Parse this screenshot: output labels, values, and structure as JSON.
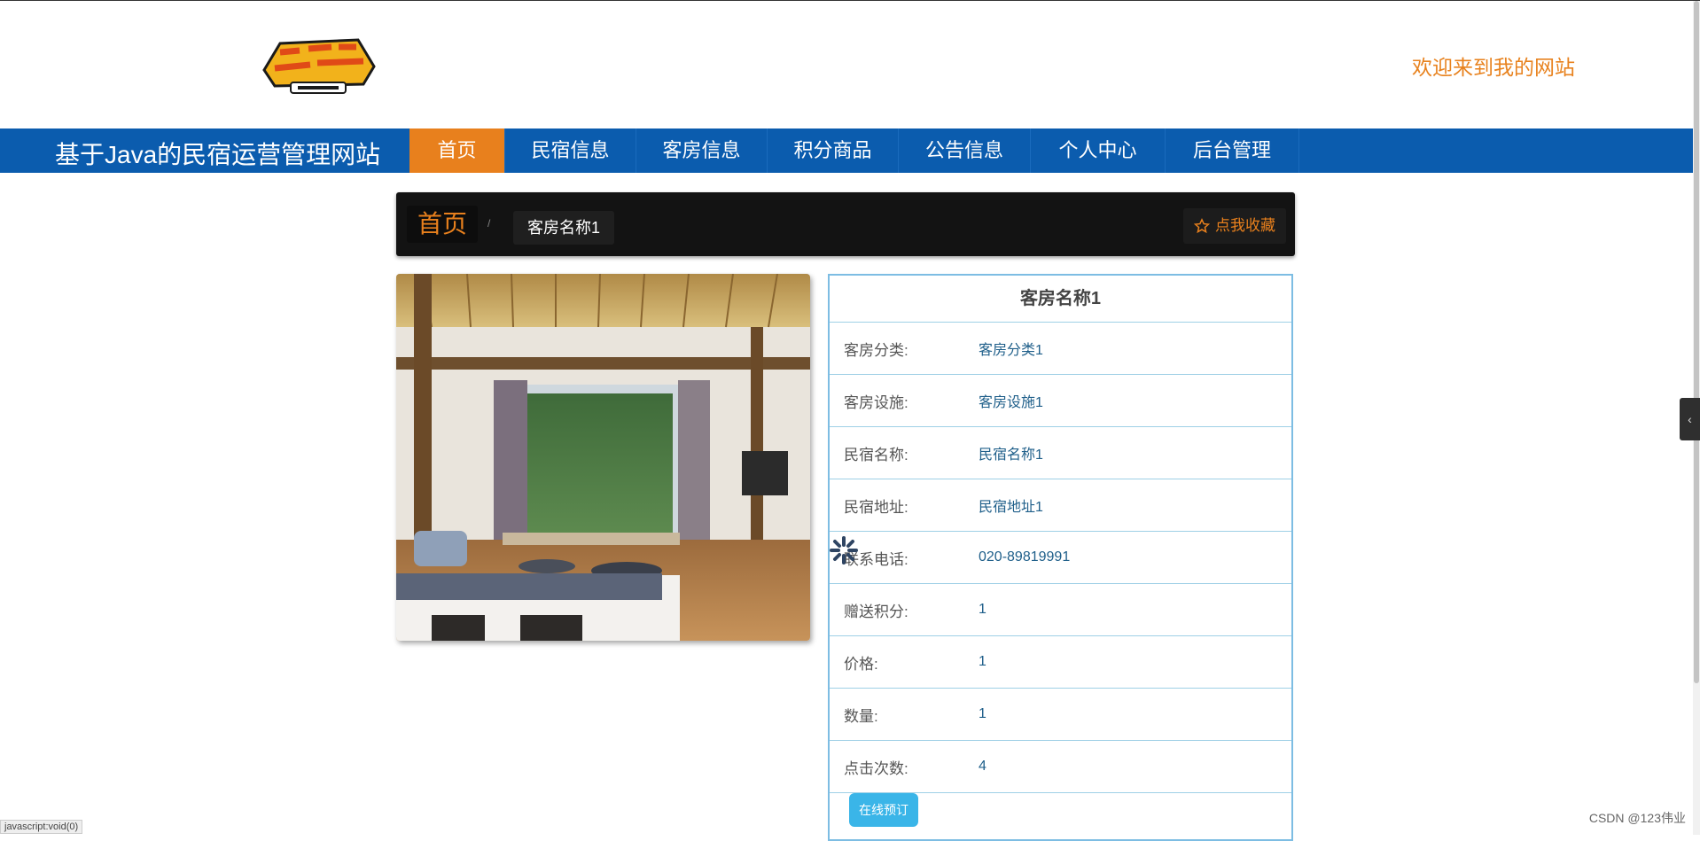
{
  "header": {
    "welcome": "欢迎来到我的网站"
  },
  "navbar": {
    "site_title": "基于Java的民宿运营管理网站",
    "items": [
      {
        "label": "首页",
        "active": true
      },
      {
        "label": "民宿信息"
      },
      {
        "label": "客房信息"
      },
      {
        "label": "积分商品"
      },
      {
        "label": "公告信息"
      },
      {
        "label": "个人中心"
      },
      {
        "label": "后台管理"
      }
    ]
  },
  "breadcrumb": {
    "home": "首页",
    "separator": "/",
    "current": "客房名称1",
    "favorite": "点我收藏"
  },
  "detail": {
    "title": "客房名称1",
    "rows": [
      {
        "label": "客房分类:",
        "value": "客房分类1"
      },
      {
        "label": "客房设施:",
        "value": "客房设施1"
      },
      {
        "label": "民宿名称:",
        "value": "民宿名称1"
      },
      {
        "label": "民宿地址:",
        "value": "民宿地址1"
      },
      {
        "label": "联系电话:",
        "value": "020-89819991"
      },
      {
        "label": "赠送积分:",
        "value": "1"
      },
      {
        "label": "价格:",
        "value": "1"
      },
      {
        "label": "数量:",
        "value": "1"
      },
      {
        "label": "点击次数:",
        "value": "4"
      }
    ],
    "book_button": "在线预订"
  },
  "status_bar": {
    "url": "javascript:void(0)"
  },
  "watermark": "CSDN @123伟业",
  "colors": {
    "nav_bg": "#0b5cae",
    "accent": "#e8801d",
    "book_btn": "#3ab5e8"
  }
}
